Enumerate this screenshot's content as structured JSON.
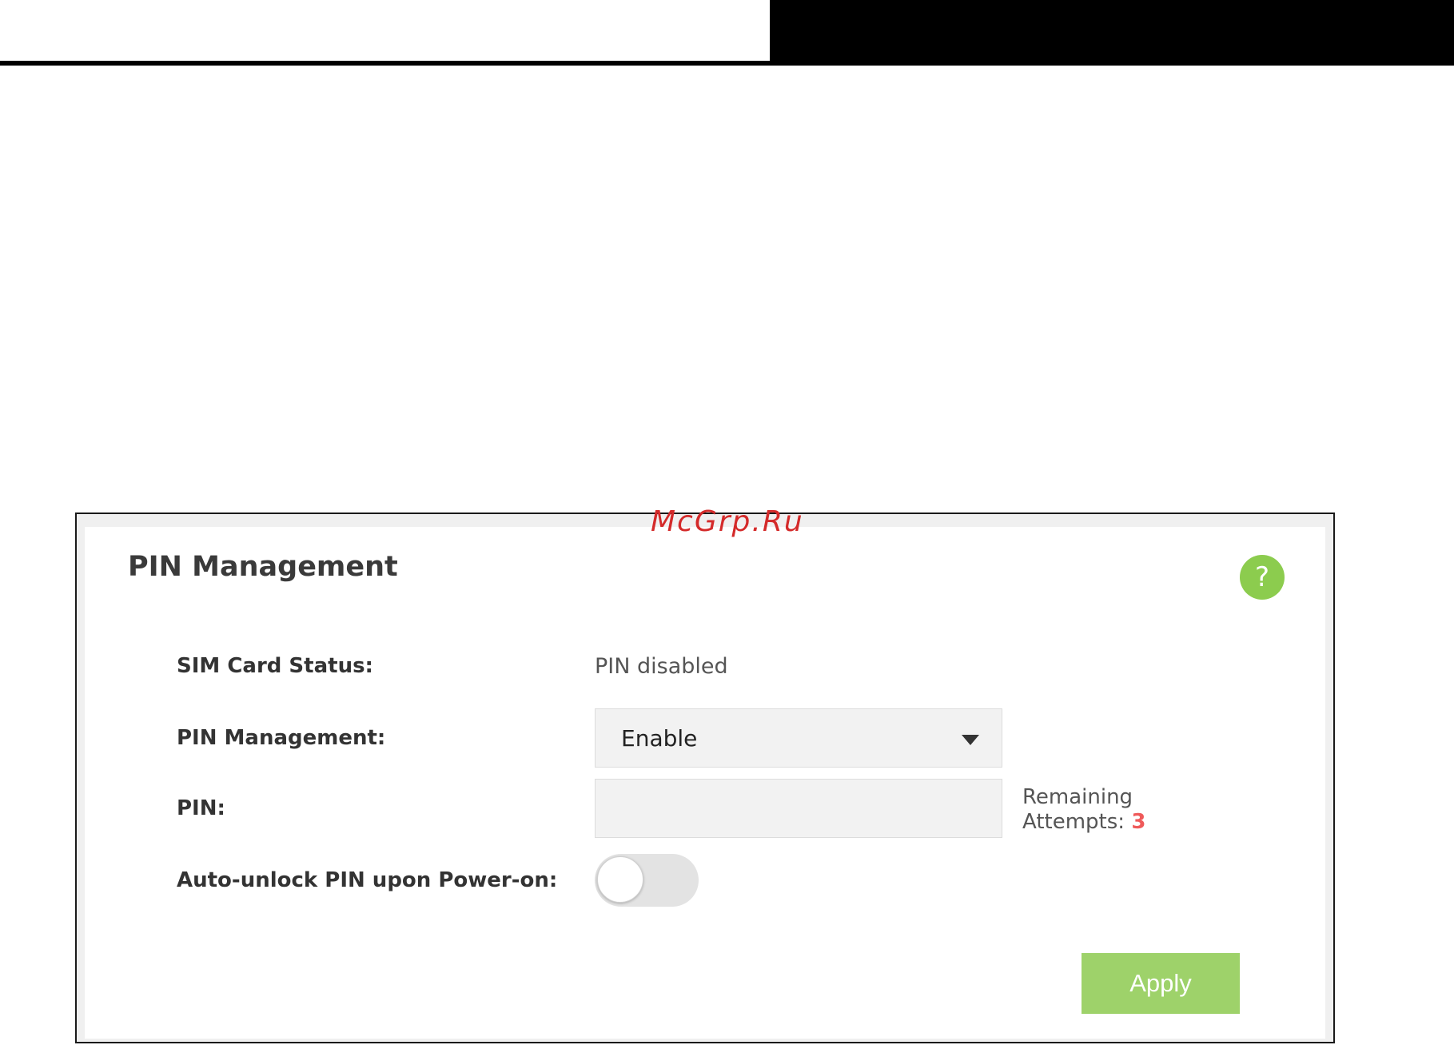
{
  "watermark": "McGrp.Ru",
  "panel": {
    "title": "PIN Management",
    "help_icon": "?"
  },
  "fields": {
    "sim_status_label": "SIM Card Status:",
    "sim_status_value": "PIN disabled",
    "pin_management_label": "PIN Management:",
    "pin_management_value": "Enable",
    "pin_label": "PIN:",
    "pin_value": "",
    "remaining_label_line1": "Remaining",
    "remaining_label_line2": "Attempts:",
    "remaining_count": "3",
    "auto_unlock_label": "Auto-unlock PIN upon Power-on:",
    "auto_unlock_on": false
  },
  "actions": {
    "apply_label": "Apply"
  },
  "colors": {
    "accent_green": "#8ccc4e",
    "apply_green": "#9ed26a",
    "attempts_red": "#ef5a5a",
    "watermark_red": "#d42a2a"
  },
  "icons": {
    "help": "question-mark-circle-icon",
    "dropdown": "chevron-down-icon"
  }
}
